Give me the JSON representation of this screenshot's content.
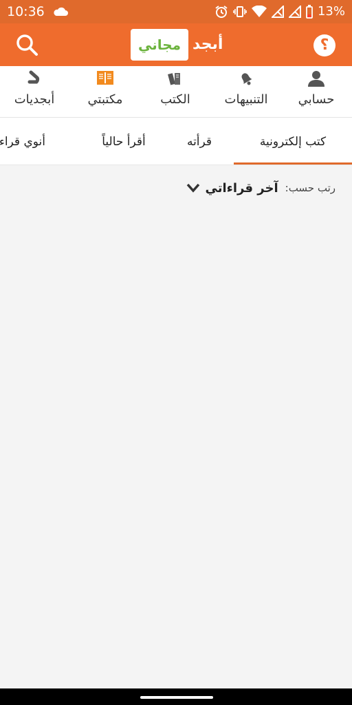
{
  "status_bar": {
    "time": "10:36",
    "battery": "13%",
    "icons": [
      "cloud-icon",
      "alarm-icon",
      "vibrate-icon",
      "wifi-icon",
      "signal-icon",
      "signal-icon",
      "battery-low-icon"
    ]
  },
  "app_bar": {
    "brand": "أبجد",
    "free_badge": "مجاني",
    "help_symbol": "؟",
    "accent_color": "#ef6c2d",
    "badge_color": "#6cb33e"
  },
  "top_nav": [
    {
      "label": "حسابي",
      "icon": "person-icon"
    },
    {
      "label": "التنبيهات",
      "icon": "bell-icon"
    },
    {
      "label": "الكتب",
      "icon": "books-icon"
    },
    {
      "label": "مكتبتي",
      "icon": "open-book-icon",
      "active": true
    },
    {
      "label": "أبجديات",
      "icon": "dal-letter-icon"
    }
  ],
  "tabs": [
    {
      "label": "كتب إلكترونية",
      "active": true
    },
    {
      "label": "قرأته"
    },
    {
      "label": "أقرأ حالياً"
    },
    {
      "label": "أنوي قراءته"
    }
  ],
  "sort": {
    "label": "رتب حسب:",
    "value": "آخر قراءاتي"
  }
}
